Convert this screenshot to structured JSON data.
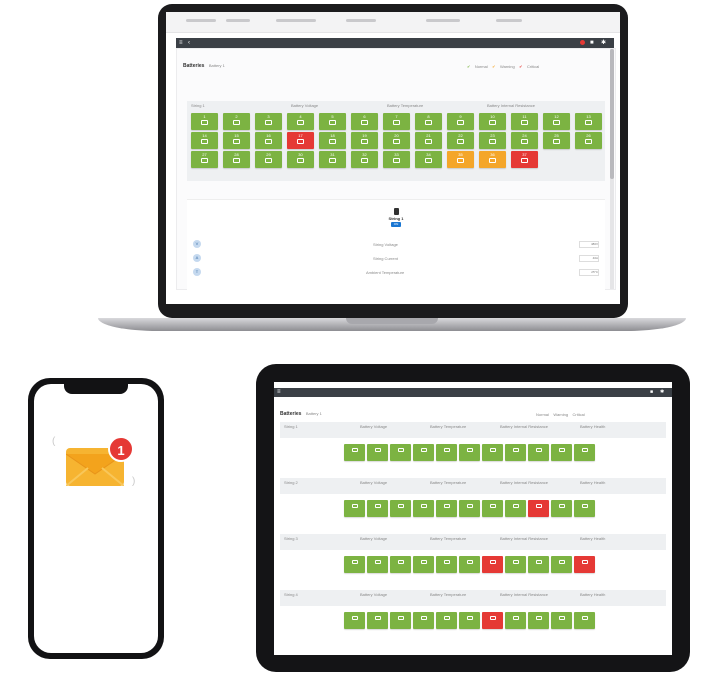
{
  "laptop": {
    "app": {
      "page_title": "Batteries",
      "page_subtitle": "Battery 1",
      "legend": [
        "Normal",
        "Warning",
        "Critical"
      ],
      "table_headers": [
        "String 1",
        "Battery Voltage",
        "Battery Temperature",
        "Battery Internal Resistance"
      ],
      "grid_rows": [
        [
          "1",
          "2",
          "3",
          "4",
          "5",
          "6",
          "7",
          "8",
          "9",
          "10",
          "11",
          "12",
          "13"
        ],
        [
          "14",
          "15",
          "16",
          "17",
          "18",
          "19",
          "20",
          "21",
          "22",
          "23",
          "24",
          "25",
          "26"
        ],
        [
          "27",
          "28",
          "29",
          "30",
          "31",
          "32",
          "33",
          "34",
          "35",
          "36",
          "37",
          "38"
        ]
      ],
      "cell_status": [
        [
          "green",
          "green",
          "green",
          "green",
          "green",
          "green",
          "green",
          "green",
          "green",
          "green",
          "green",
          "green",
          "green"
        ],
        [
          "green",
          "green",
          "green",
          "red",
          "green",
          "green",
          "green",
          "green",
          "green",
          "green",
          "green",
          "green",
          "green"
        ],
        [
          "green",
          "green",
          "green",
          "green",
          "green",
          "green",
          "green",
          "green",
          "orange",
          "orange",
          "red"
        ]
      ],
      "detail": {
        "title": "String 1",
        "badge": "ON",
        "rows": [
          {
            "label": "String Voltage",
            "value": "480V"
          },
          {
            "label": "String Current",
            "value": "40A"
          },
          {
            "label": "Ambient Temperature",
            "value": "25°C"
          }
        ]
      }
    }
  },
  "phone": {
    "notification_count": "1",
    "icon": "envelope-icon"
  },
  "tablet": {
    "app": {
      "page_title": "Batteries",
      "page_subtitle": "Battery 1",
      "legend": [
        "Normal",
        "Warning",
        "Critical"
      ],
      "strings": [
        {
          "label": "String 1",
          "headers": [
            "Battery Voltage",
            "Battery Temperature",
            "Battery Internal Resistance",
            "Battery Health"
          ],
          "cells": [
            "green",
            "green",
            "green",
            "green",
            "green",
            "green",
            "green",
            "green",
            "green",
            "green",
            "green"
          ]
        },
        {
          "label": "String 2",
          "headers": [
            "Battery Voltage",
            "Battery Temperature",
            "Battery Internal Resistance",
            "Battery Health"
          ],
          "cells": [
            "green",
            "green",
            "green",
            "green",
            "green",
            "green",
            "green",
            "green",
            "red",
            "green",
            "green"
          ]
        },
        {
          "label": "String 3",
          "headers": [
            "Battery Voltage",
            "Battery Temperature",
            "Battery Internal Resistance",
            "Battery Health"
          ],
          "cells": [
            "green",
            "green",
            "green",
            "green",
            "green",
            "green",
            "red",
            "green",
            "green",
            "green",
            "red"
          ]
        },
        {
          "label": "String 4",
          "headers": [
            "Battery Voltage",
            "Battery Temperature",
            "Battery Internal Resistance",
            "Battery Health"
          ],
          "cells": [
            "green",
            "green",
            "green",
            "green",
            "green",
            "green",
            "red",
            "green",
            "green",
            "green",
            "green"
          ]
        }
      ]
    }
  },
  "colors": {
    "normal": "#7cb342",
    "warning": "#f4a62a",
    "critical": "#e53935",
    "appbar": "#3b4046"
  }
}
